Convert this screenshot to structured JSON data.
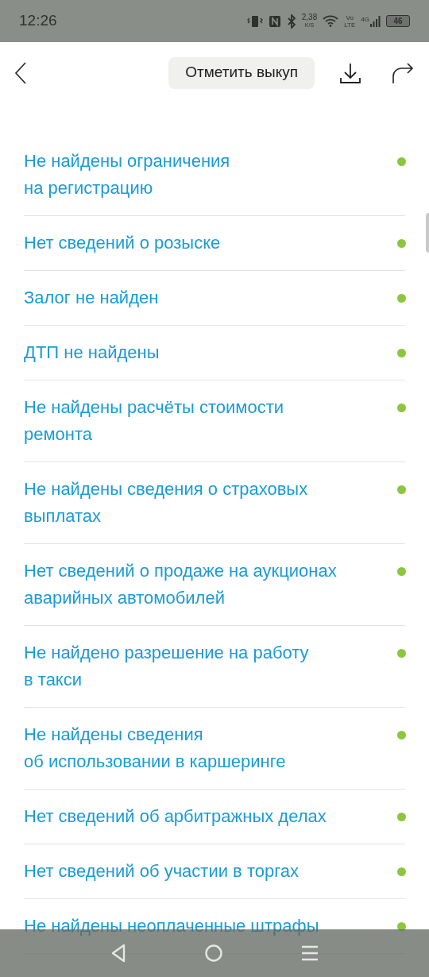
{
  "status_bar": {
    "time": "12:26",
    "speed": "2,38",
    "speed_unit": "K/S",
    "volte_top": "Vo",
    "volte_bottom": "LTE",
    "network": "4G",
    "battery": "46"
  },
  "header": {
    "action_button": "Отметить выкуп"
  },
  "checks": [
    {
      "text": "Не найдены ограничения\nна регистрацию",
      "color": "#8cc63e"
    },
    {
      "text": "Нет сведений о розыске",
      "color": "#8cc63e"
    },
    {
      "text": "Залог не найден",
      "color": "#8cc63e"
    },
    {
      "text": "ДТП не найдены",
      "color": "#8cc63e"
    },
    {
      "text": "Не найдены расчёты стоимости\nремонта",
      "color": "#8cc63e"
    },
    {
      "text": "Не найдены сведения о страховых\nвыплатах",
      "color": "#8cc63e"
    },
    {
      "text": "Нет сведений о продаже на аукционах\nаварийных автомобилей",
      "color": "#8cc63e"
    },
    {
      "text": "Не найдено разрешение на работу\nв такси",
      "color": "#8cc63e"
    },
    {
      "text": "Не найдены сведения\nоб использовании в каршеринге",
      "color": "#8cc63e"
    },
    {
      "text": "Нет сведений об арбитражных делах",
      "color": "#8cc63e"
    },
    {
      "text": "Нет сведений об участии в торгах",
      "color": "#8cc63e"
    },
    {
      "text": "Не найдены неоплаченные штрафы",
      "color": "#8cc63e"
    }
  ]
}
